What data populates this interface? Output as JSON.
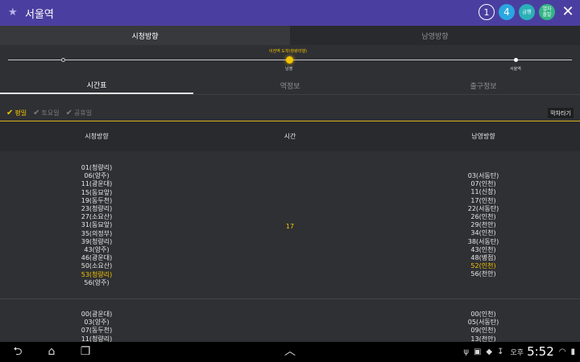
{
  "header": {
    "title": "서울역",
    "badge1": "1",
    "badge4": "4",
    "badge_g": "급행",
    "badge_n": "열차\n출발"
  },
  "direction_tabs": [
    {
      "label": "시청방향",
      "active": true
    },
    {
      "label": "남영방향",
      "active": false
    }
  ],
  "route": {
    "arrival_text": "이전역 도착(청량리행)",
    "station_current": "남영",
    "station_right": "서울역"
  },
  "sub_tabs": [
    {
      "label": "시간표",
      "active": true
    },
    {
      "label": "역정보",
      "active": false
    },
    {
      "label": "출구정보",
      "active": false
    }
  ],
  "days": [
    {
      "label": "평일",
      "active": true
    },
    {
      "label": "토요일",
      "active": false
    },
    {
      "label": "공휴일",
      "active": false
    }
  ],
  "last_train_label": "막차타기",
  "table": {
    "headers": {
      "left": "시청방향",
      "mid": "시간",
      "right": "남영방향"
    },
    "block1": {
      "hour": "17",
      "left": [
        "01(청량리)",
        "06(양주)",
        "11(광운대)",
        "15(동묘앞)",
        "19(동두천)",
        "23(청량리)",
        "27(소요산)",
        "31(동묘앞)",
        "35(의정부)",
        "39(청량리)",
        "43(양주)",
        "46(광운대)",
        "50(소요산)",
        "53(청량리)",
        "56(양주)"
      ],
      "right": [
        "03(서동탄)",
        "07(인천)",
        "11(신창)",
        "17(인천)",
        "22(서동탄)",
        "26(인천)",
        "29(천안)",
        "34(인천)",
        "38(서동탄)",
        "43(인천)",
        "48(병점)",
        "52(인천)",
        "56(천안)"
      ]
    },
    "block2": {
      "left": [
        "00(광운대)",
        "03(양주)",
        "07(동두천)",
        "11(청량리)"
      ],
      "right": [
        "00(인천)",
        "05(서동탄)",
        "09(인천)",
        "13(천안)"
      ]
    }
  },
  "statusbar": {
    "ampm": "오후",
    "time": "5:52"
  },
  "colors": {
    "header": "#4a3fa0",
    "accent": "#f4c400"
  }
}
